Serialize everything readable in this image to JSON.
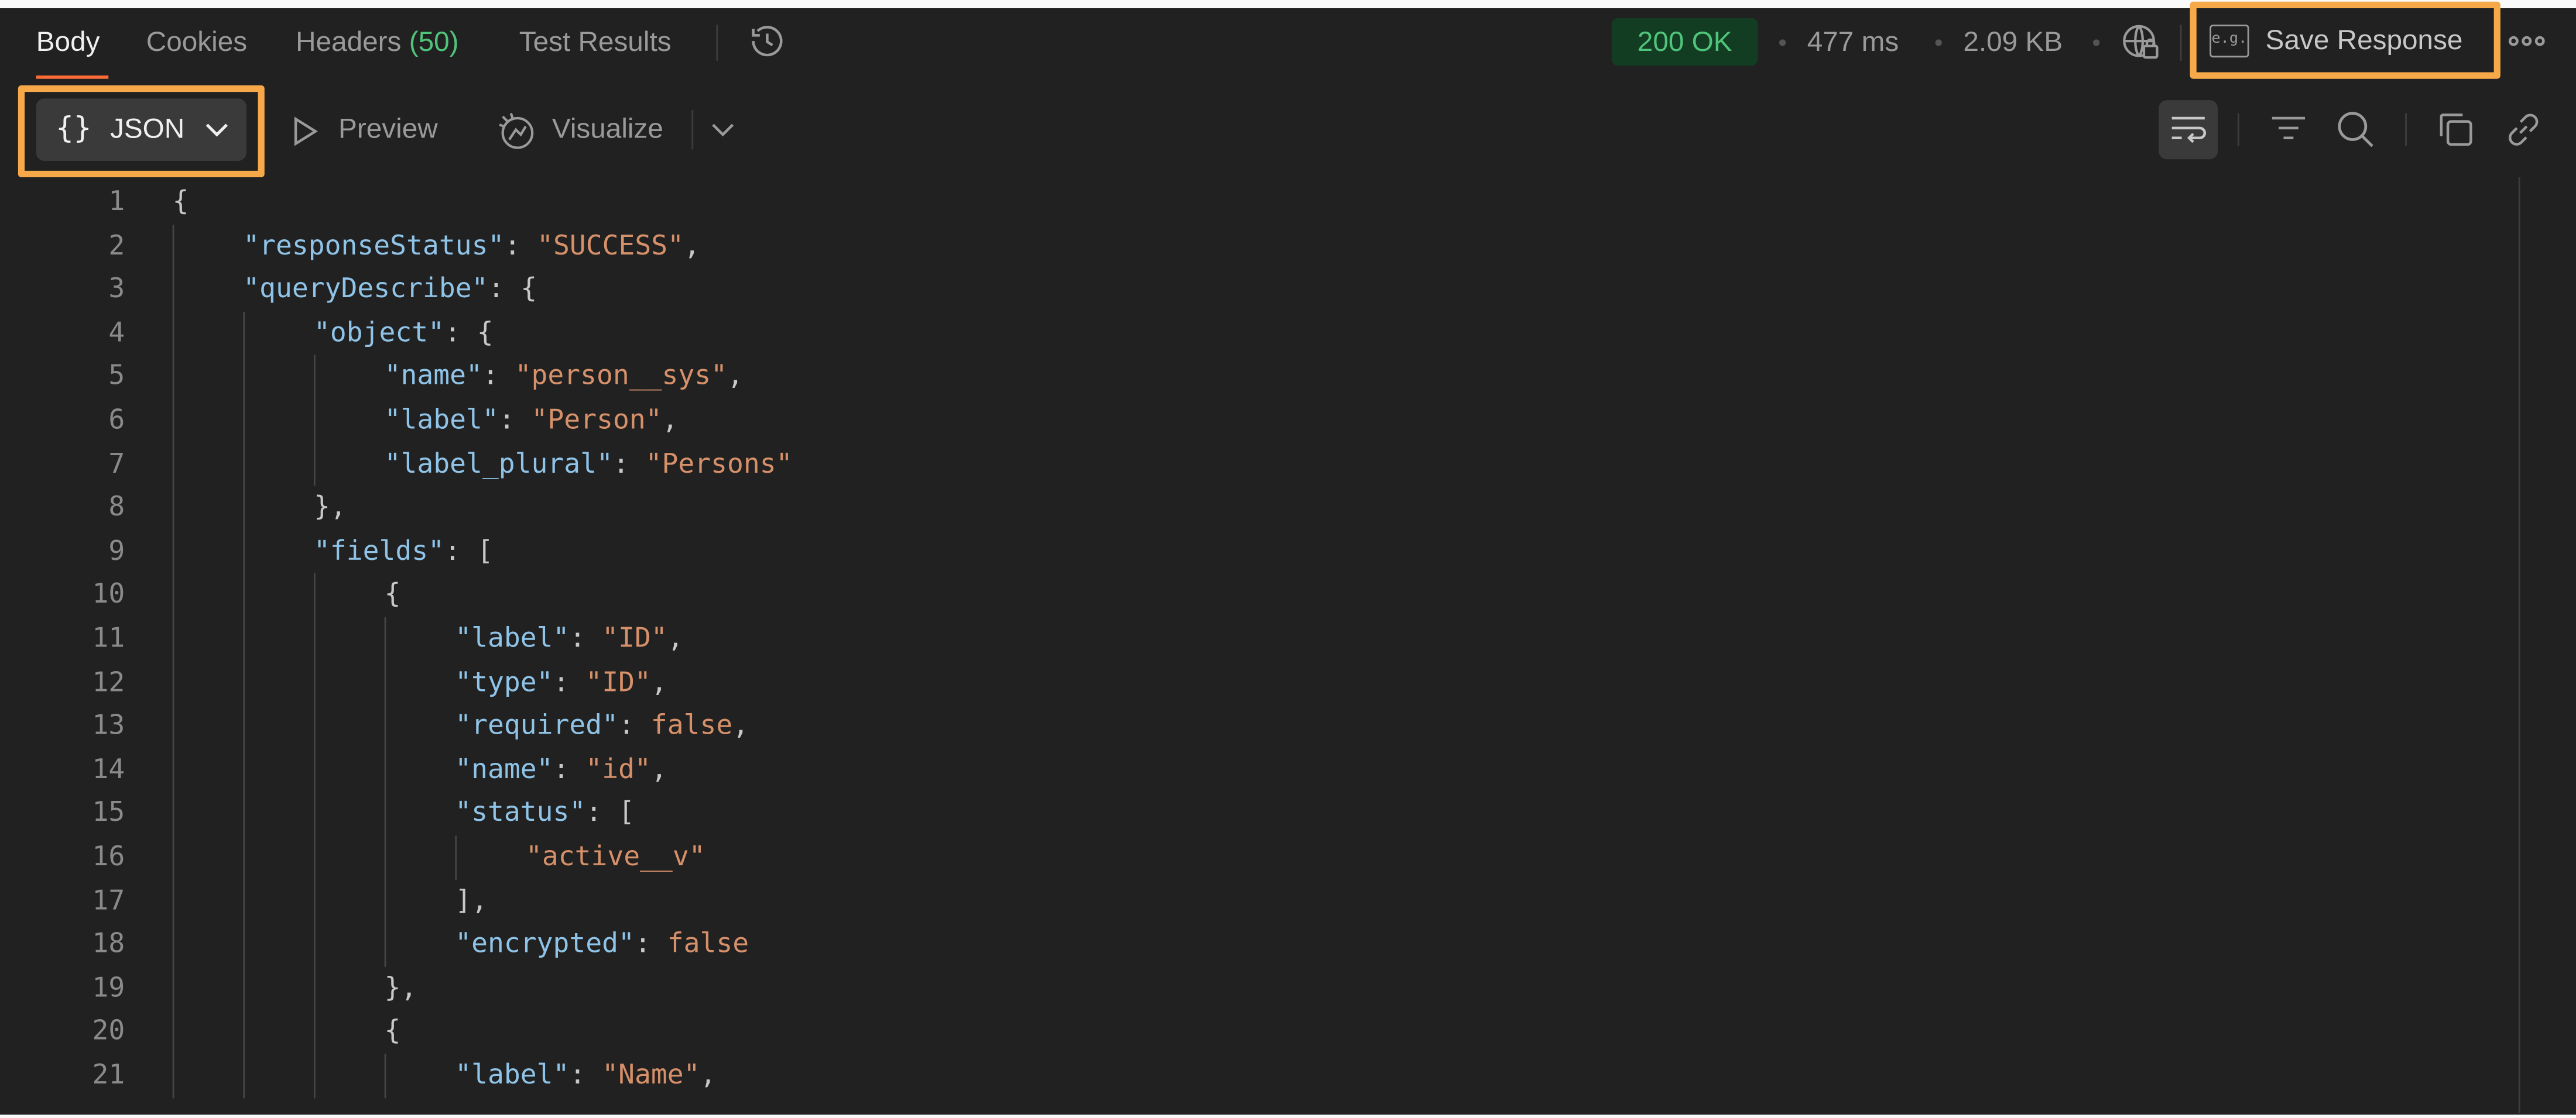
{
  "tabs": [
    {
      "label": "Body"
    },
    {
      "label": "Cookies"
    },
    {
      "label": "Headers",
      "count": "(50)"
    },
    {
      "label": "Test Results"
    }
  ],
  "status": {
    "code": "200 OK",
    "time": "477 ms",
    "size": "2.09 KB"
  },
  "save_response": {
    "icon_text": "e.g.",
    "label": "Save Response"
  },
  "format": {
    "label": "JSON"
  },
  "view_options": {
    "preview": "Preview",
    "visualize": "Visualize"
  },
  "icons": {
    "history": "history-icon",
    "network": "globe-lock-icon",
    "more": "more-horizontal-icon",
    "braces": "braces-icon",
    "chevron": "chevron-down-icon",
    "play": "play-icon",
    "visualize": "visualize-icon",
    "wrap": "wrap-lines-icon",
    "filter": "filter-icon",
    "search": "search-icon",
    "copy": "copy-icon",
    "link": "link-icon"
  },
  "colors": {
    "accent": "#ff6c37",
    "highlight": "#f7a94a",
    "success": "#4fc47a",
    "json_key": "#8fc4e8",
    "json_string": "#d6906a"
  },
  "code": {
    "lines": [
      {
        "n": "1",
        "indent": 0,
        "tokens": [
          {
            "t": "{",
            "c": "pun"
          }
        ]
      },
      {
        "n": "2",
        "indent": 1,
        "tokens": [
          {
            "t": "\"responseStatus\"",
            "c": "key"
          },
          {
            "t": ": ",
            "c": "pun"
          },
          {
            "t": "\"SUCCESS\"",
            "c": "str"
          },
          {
            "t": ",",
            "c": "pun"
          }
        ]
      },
      {
        "n": "3",
        "indent": 1,
        "tokens": [
          {
            "t": "\"queryDescribe\"",
            "c": "key"
          },
          {
            "t": ": {",
            "c": "pun"
          }
        ]
      },
      {
        "n": "4",
        "indent": 2,
        "tokens": [
          {
            "t": "\"object\"",
            "c": "key"
          },
          {
            "t": ": {",
            "c": "pun"
          }
        ]
      },
      {
        "n": "5",
        "indent": 3,
        "tokens": [
          {
            "t": "\"name\"",
            "c": "key"
          },
          {
            "t": ": ",
            "c": "pun"
          },
          {
            "t": "\"person__sys\"",
            "c": "str"
          },
          {
            "t": ",",
            "c": "pun"
          }
        ]
      },
      {
        "n": "6",
        "indent": 3,
        "tokens": [
          {
            "t": "\"label\"",
            "c": "key"
          },
          {
            "t": ": ",
            "c": "pun"
          },
          {
            "t": "\"Person\"",
            "c": "str"
          },
          {
            "t": ",",
            "c": "pun"
          }
        ]
      },
      {
        "n": "7",
        "indent": 3,
        "tokens": [
          {
            "t": "\"label_plural\"",
            "c": "key"
          },
          {
            "t": ": ",
            "c": "pun"
          },
          {
            "t": "\"Persons\"",
            "c": "str"
          }
        ]
      },
      {
        "n": "8",
        "indent": 2,
        "tokens": [
          {
            "t": "},",
            "c": "pun"
          }
        ]
      },
      {
        "n": "9",
        "indent": 2,
        "tokens": [
          {
            "t": "\"fields\"",
            "c": "key"
          },
          {
            "t": ": [",
            "c": "pun"
          }
        ]
      },
      {
        "n": "10",
        "indent": 3,
        "tokens": [
          {
            "t": "{",
            "c": "pun"
          }
        ]
      },
      {
        "n": "11",
        "indent": 4,
        "tokens": [
          {
            "t": "\"label\"",
            "c": "key"
          },
          {
            "t": ": ",
            "c": "pun"
          },
          {
            "t": "\"ID\"",
            "c": "str"
          },
          {
            "t": ",",
            "c": "pun"
          }
        ]
      },
      {
        "n": "12",
        "indent": 4,
        "tokens": [
          {
            "t": "\"type\"",
            "c": "key"
          },
          {
            "t": ": ",
            "c": "pun"
          },
          {
            "t": "\"ID\"",
            "c": "str"
          },
          {
            "t": ",",
            "c": "pun"
          }
        ]
      },
      {
        "n": "13",
        "indent": 4,
        "tokens": [
          {
            "t": "\"required\"",
            "c": "key"
          },
          {
            "t": ": ",
            "c": "pun"
          },
          {
            "t": "false",
            "c": "lit"
          },
          {
            "t": ",",
            "c": "pun"
          }
        ]
      },
      {
        "n": "14",
        "indent": 4,
        "tokens": [
          {
            "t": "\"name\"",
            "c": "key"
          },
          {
            "t": ": ",
            "c": "pun"
          },
          {
            "t": "\"id\"",
            "c": "str"
          },
          {
            "t": ",",
            "c": "pun"
          }
        ]
      },
      {
        "n": "15",
        "indent": 4,
        "tokens": [
          {
            "t": "\"status\"",
            "c": "key"
          },
          {
            "t": ": [",
            "c": "pun"
          }
        ]
      },
      {
        "n": "16",
        "indent": 5,
        "tokens": [
          {
            "t": "\"active__v\"",
            "c": "str"
          }
        ]
      },
      {
        "n": "17",
        "indent": 4,
        "tokens": [
          {
            "t": "],",
            "c": "pun"
          }
        ]
      },
      {
        "n": "18",
        "indent": 4,
        "tokens": [
          {
            "t": "\"encrypted\"",
            "c": "key"
          },
          {
            "t": ": ",
            "c": "pun"
          },
          {
            "t": "false",
            "c": "lit"
          }
        ]
      },
      {
        "n": "19",
        "indent": 3,
        "tokens": [
          {
            "t": "},",
            "c": "pun"
          }
        ]
      },
      {
        "n": "20",
        "indent": 3,
        "tokens": [
          {
            "t": "{",
            "c": "pun"
          }
        ]
      },
      {
        "n": "21",
        "indent": 4,
        "tokens": [
          {
            "t": "\"label\"",
            "c": "key"
          },
          {
            "t": ": ",
            "c": "pun"
          },
          {
            "t": "\"Name\"",
            "c": "str"
          },
          {
            "t": ",",
            "c": "pun"
          }
        ]
      }
    ]
  }
}
